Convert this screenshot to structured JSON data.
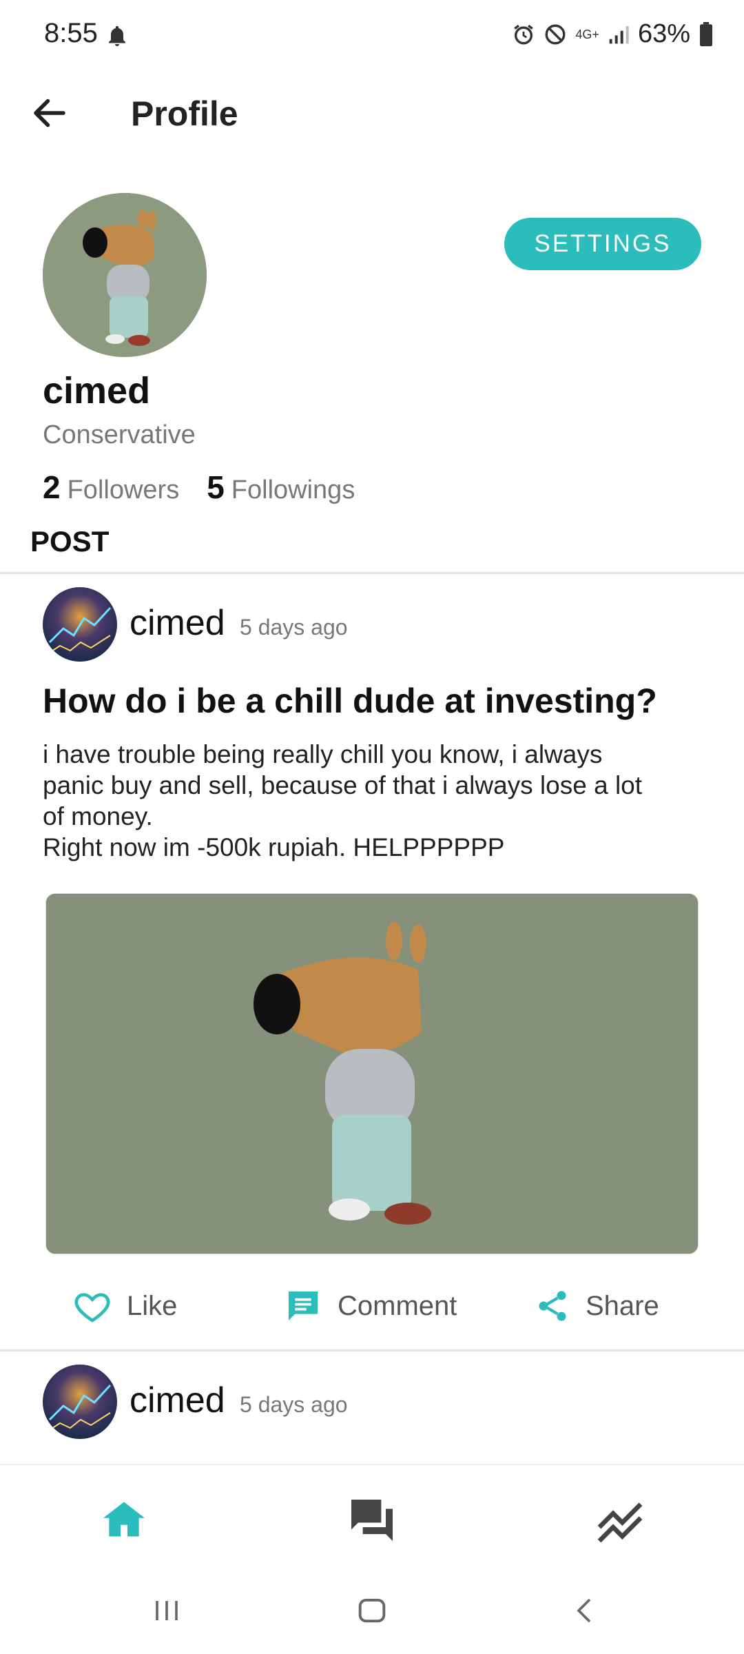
{
  "status_bar": {
    "time": "8:55",
    "network": "4G+",
    "battery": "63%",
    "icons": [
      "bell-icon",
      "alarm-icon",
      "do-not-disturb-icon",
      "signal-icon",
      "battery-icon"
    ]
  },
  "header": {
    "title": "Profile",
    "back_icon": "arrow-left-icon"
  },
  "profile": {
    "username": "cimed",
    "bio": "Conservative",
    "followers_count": "2",
    "followers_label": "Followers",
    "followings_count": "5",
    "followings_label": "Followings",
    "settings_label": "SETTINGS"
  },
  "section_title": "POST",
  "posts": [
    {
      "author": "cimed",
      "time": "5 days ago",
      "title": "How do i be a chill dude at investing?",
      "body": "i have trouble being really chill you know, i always\npanic buy and sell, because of that i always lose a lot\nof money.\nRight now im -500k rupiah. HELPPPPPP",
      "actions": {
        "like": "Like",
        "comment": "Comment",
        "share": "Share"
      }
    },
    {
      "author": "cimed",
      "time": "5 days ago"
    }
  ],
  "bottom_nav": {
    "items": [
      "home-icon",
      "forum-icon",
      "market-trend-icon"
    ]
  },
  "colors": {
    "accent": "#2bbcbc",
    "muted_text": "#777777",
    "image_background": "#86917c"
  }
}
